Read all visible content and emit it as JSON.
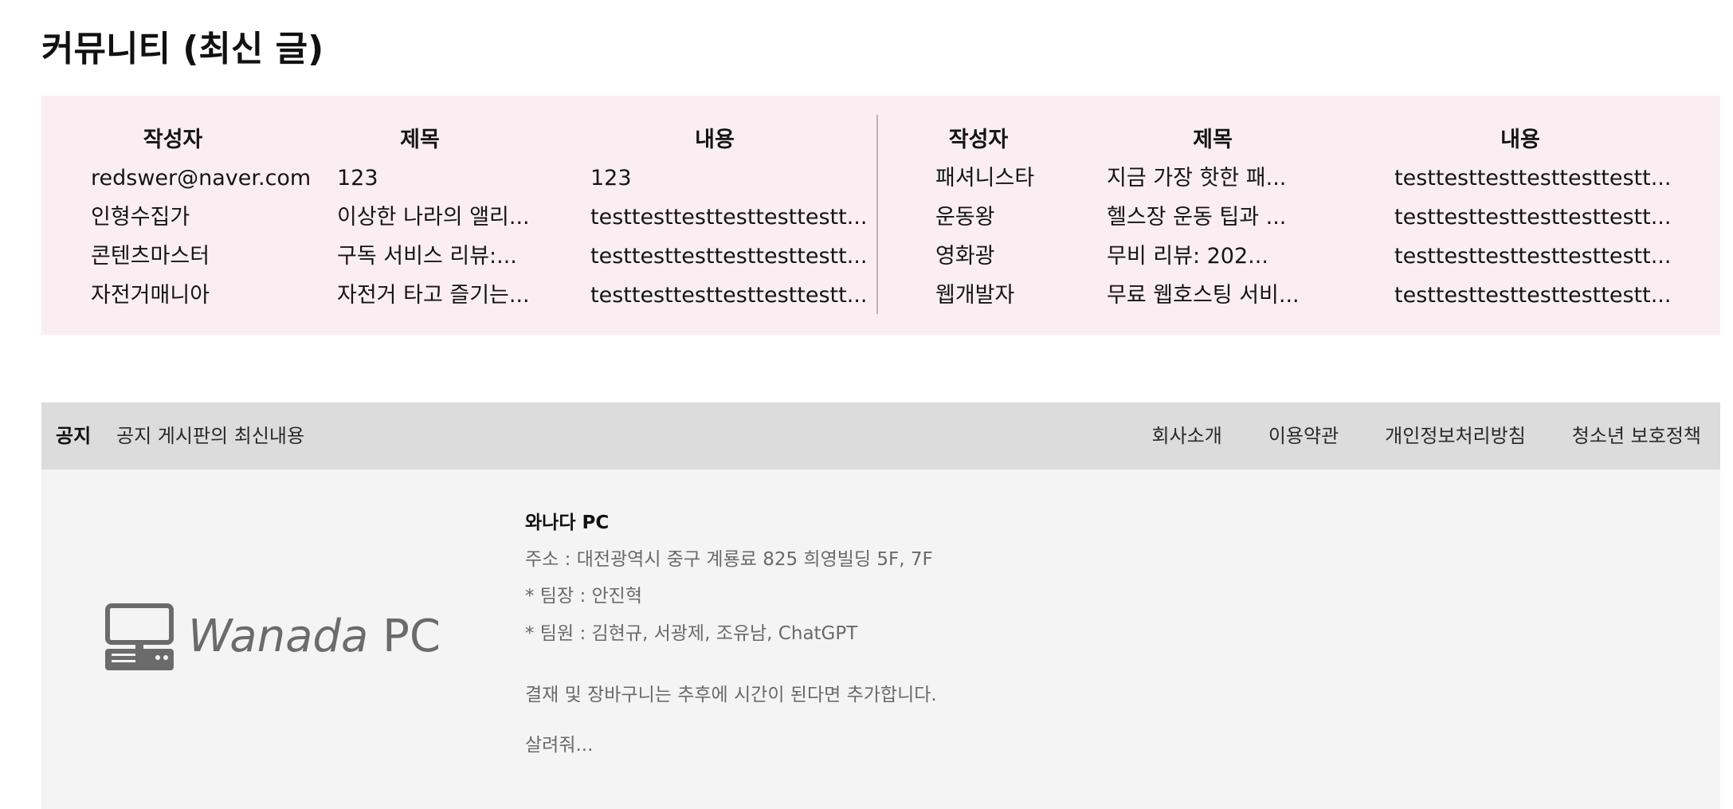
{
  "page": {
    "title": "커뮤니티 (최신 글)"
  },
  "community": {
    "left": {
      "headers": [
        "작성자",
        "제목",
        "내용"
      ],
      "rows": [
        [
          "redswer@naver.com",
          "123",
          "123"
        ],
        [
          "인형수집가",
          "이상한 나라의 앨리...",
          "testtesttesttesttesttestt..."
        ],
        [
          "콘텐츠마스터",
          "구독 서비스 리뷰:...",
          "testtesttesttesttesttestt..."
        ],
        [
          "자전거매니아",
          "자전거 타고 즐기는...",
          "testtesttesttesttesttestt..."
        ]
      ]
    },
    "right": {
      "headers": [
        "작성자",
        "제목",
        "내용"
      ],
      "rows": [
        [
          "패셔니스타",
          "지금 가장 핫한 패...",
          "testtesttesttesttesttestt..."
        ],
        [
          "운동왕",
          "헬스장 운동 팁과 ...",
          "testtesttesttesttesttestt..."
        ],
        [
          "영화광",
          "무비 리뷰: 202...",
          "testtesttesttesttesttestt..."
        ],
        [
          "웹개발자",
          "무료 웹호스팅 서비...",
          "testtesttesttesttesttestt..."
        ]
      ]
    }
  },
  "footer": {
    "notice_label": "공지",
    "notice_text": "공지 게시판의 최신내용",
    "links": [
      "회사소개",
      "이용약관",
      "개인정보처리방침",
      "청소년 보호정책"
    ]
  },
  "info": {
    "logo_word": "Wanada",
    "logo_suffix": "PC",
    "logo_icon": "computer-icon",
    "company": "와나다 PC",
    "address": "주소 : 대전광역시 중구 계룡료 825 희영빌딩 5F, 7F",
    "leader": "* 팀장 : 안진혁",
    "members": "* 팀원 : 김현규, 서광제, 조유남, ChatGPT",
    "note": "결재 및 장바구니는 추후에 시간이 된다면 추가합니다.",
    "plea": "살려줘..."
  },
  "colors": {
    "community_bg": "#fbeef2",
    "footer_bar_bg": "#dcdcdc",
    "info_bg": "#f4f4f4",
    "logo_gray": "#6b6b6b"
  }
}
